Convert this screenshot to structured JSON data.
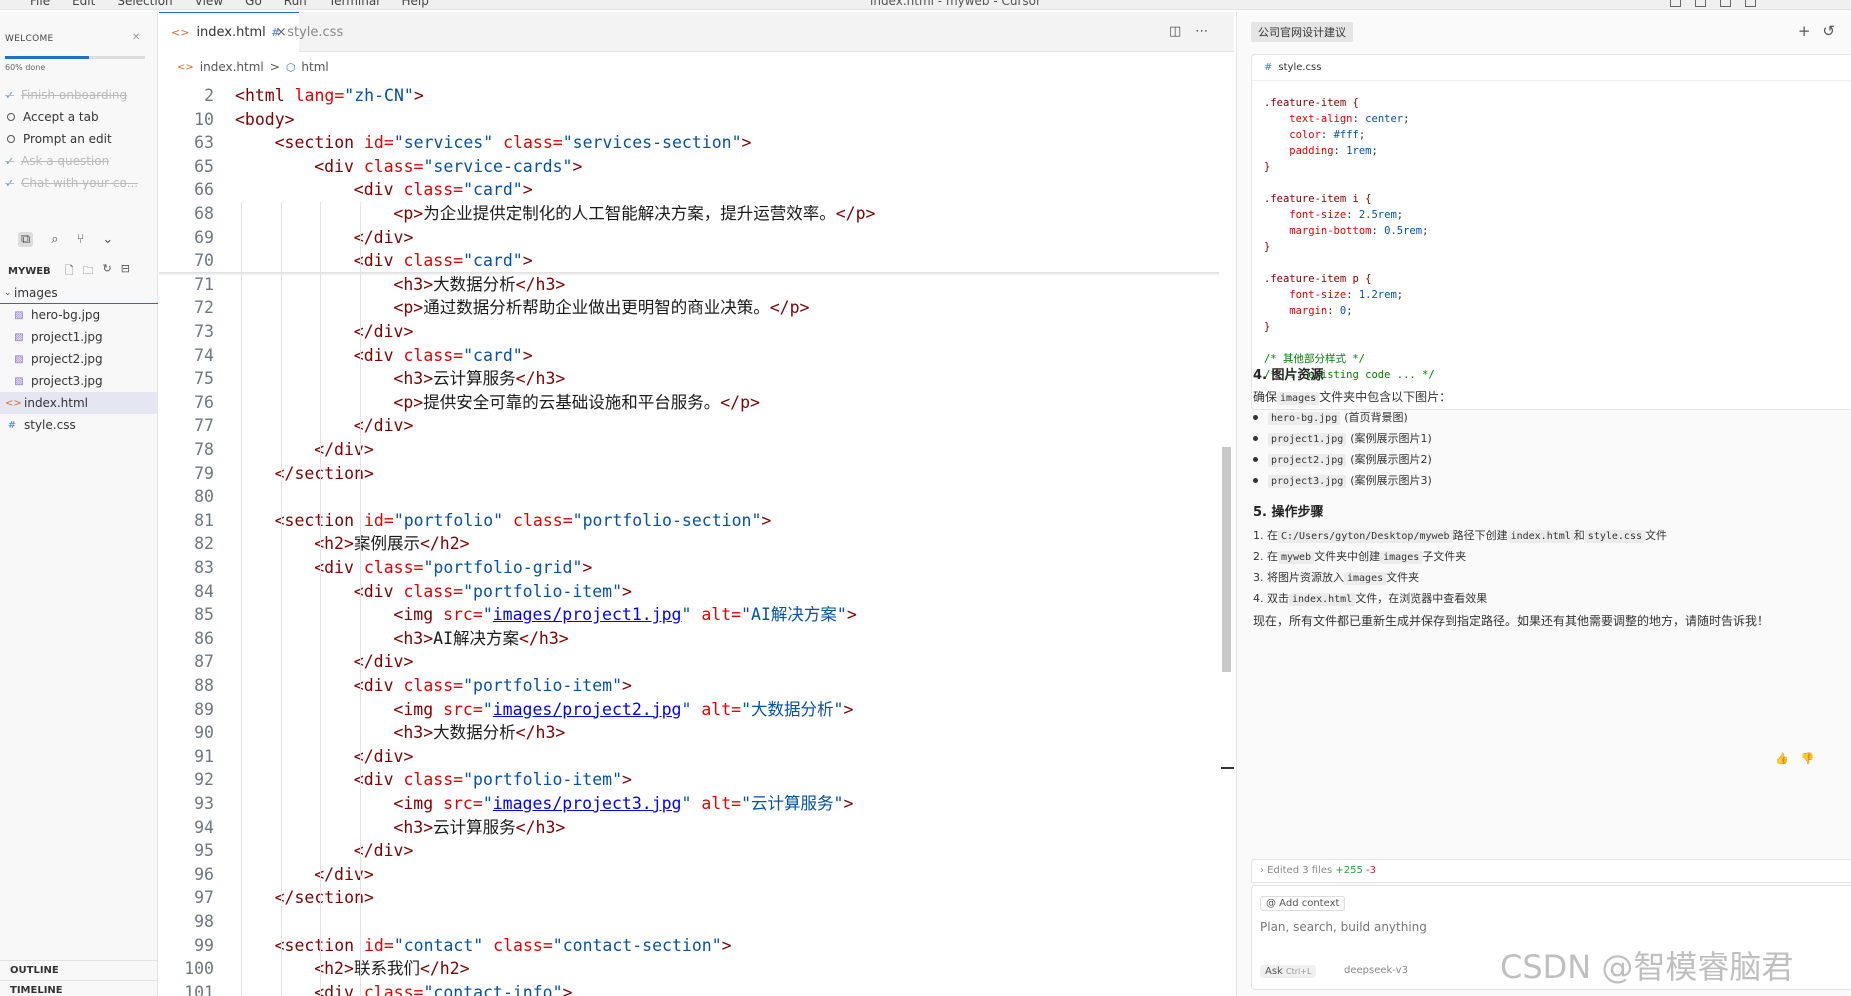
{
  "menubar": {
    "menus": [
      "File",
      "Edit",
      "Selection",
      "View",
      "Go",
      "Run",
      "Terminal",
      "Help"
    ],
    "window_title": "index.html - myweb - Cursor"
  },
  "welcome": {
    "title": "WELCOME",
    "progress_label": "60% done",
    "progress_fraction": 0.6,
    "items": [
      {
        "label": "Finish onboarding",
        "done": true
      },
      {
        "label": "Accept a tab",
        "done": false
      },
      {
        "label": "Prompt an edit",
        "done": false
      },
      {
        "label": "Ask a question",
        "done": true
      },
      {
        "label": "Chat with your co...",
        "done": true
      }
    ]
  },
  "explorer": {
    "title": "MYWEB",
    "folder": "images",
    "files": [
      "hero-bg.jpg",
      "project1.jpg",
      "project2.jpg",
      "project3.jpg"
    ],
    "root_files": [
      "index.html",
      "style.css"
    ],
    "outline": "OUTLINE",
    "timeline": "TIMELINE"
  },
  "tabs": [
    {
      "label": "index.html",
      "active": true,
      "close": "×"
    },
    {
      "label": "style.css",
      "active": false
    }
  ],
  "breadcrumb": {
    "file": "index.html",
    "sep": ">",
    "node": "html"
  },
  "code_lines": [
    {
      "n": "2",
      "ind": 0,
      "h": [
        [
          "<",
          "t"
        ],
        [
          "html ",
          "t"
        ],
        [
          "lang=",
          "a"
        ],
        [
          "\"zh-CN\"",
          "v"
        ],
        [
          ">",
          "t"
        ]
      ]
    },
    {
      "n": "10",
      "ind": 0,
      "h": [
        [
          "<body>",
          "t"
        ]
      ]
    },
    {
      "n": "63",
      "ind": 1,
      "h": [
        [
          "<section ",
          "t"
        ],
        [
          "id=",
          "a"
        ],
        [
          "\"services\" ",
          "v"
        ],
        [
          "class=",
          "a"
        ],
        [
          "\"services-section\"",
          "v"
        ],
        [
          ">",
          "t"
        ]
      ]
    },
    {
      "n": "65",
      "ind": 2,
      "h": [
        [
          "<div ",
          "t"
        ],
        [
          "class=",
          "a"
        ],
        [
          "\"service-cards\"",
          "v"
        ],
        [
          ">",
          "t"
        ]
      ]
    },
    {
      "n": "66",
      "ind": 3,
      "h": [
        [
          "<div ",
          "t"
        ],
        [
          "class=",
          "a"
        ],
        [
          "\"card\"",
          "v"
        ],
        [
          ">",
          "t"
        ]
      ]
    },
    {
      "n": "68",
      "ind": 4,
      "h": [
        [
          "<p>",
          "t"
        ],
        [
          "为企业提供定制化的人工智能解决方案，提升运营效率。",
          ""
        ],
        [
          "</p>",
          "t"
        ]
      ]
    },
    {
      "n": "69",
      "ind": 3,
      "h": [
        [
          "</div>",
          "t"
        ]
      ]
    },
    {
      "n": "70",
      "ind": 3,
      "h": [
        [
          "<div ",
          "t"
        ],
        [
          "class=",
          "a"
        ],
        [
          "\"card\"",
          "v"
        ],
        [
          ">",
          "t"
        ]
      ]
    },
    {
      "n": "71",
      "ind": 4,
      "h": [
        [
          "<h3>",
          "t"
        ],
        [
          "大数据分析",
          ""
        ],
        [
          "</h3>",
          "t"
        ]
      ]
    },
    {
      "n": "72",
      "ind": 4,
      "h": [
        [
          "<p>",
          "t"
        ],
        [
          "通过数据分析帮助企业做出更明智的商业决策。",
          ""
        ],
        [
          "</p>",
          "t"
        ]
      ]
    },
    {
      "n": "73",
      "ind": 3,
      "h": [
        [
          "</div>",
          "t"
        ]
      ]
    },
    {
      "n": "74",
      "ind": 3,
      "h": [
        [
          "<div ",
          "t"
        ],
        [
          "class=",
          "a"
        ],
        [
          "\"card\"",
          "v"
        ],
        [
          ">",
          "t"
        ]
      ]
    },
    {
      "n": "75",
      "ind": 4,
      "h": [
        [
          "<h3>",
          "t"
        ],
        [
          "云计算服务",
          ""
        ],
        [
          "</h3>",
          "t"
        ]
      ]
    },
    {
      "n": "76",
      "ind": 4,
      "h": [
        [
          "<p>",
          "t"
        ],
        [
          "提供安全可靠的云基础设施和平台服务。",
          ""
        ],
        [
          "</p>",
          "t"
        ]
      ]
    },
    {
      "n": "77",
      "ind": 3,
      "h": [
        [
          "</div>",
          "t"
        ]
      ]
    },
    {
      "n": "78",
      "ind": 2,
      "h": [
        [
          "</div>",
          "t"
        ]
      ]
    },
    {
      "n": "79",
      "ind": 1,
      "h": [
        [
          "</section>",
          "t"
        ]
      ]
    },
    {
      "n": "80",
      "ind": 0,
      "h": []
    },
    {
      "n": "81",
      "ind": 1,
      "h": [
        [
          "<section ",
          "t"
        ],
        [
          "id=",
          "a"
        ],
        [
          "\"portfolio\" ",
          "v"
        ],
        [
          "class=",
          "a"
        ],
        [
          "\"portfolio-section\"",
          "v"
        ],
        [
          ">",
          "t"
        ]
      ]
    },
    {
      "n": "82",
      "ind": 2,
      "h": [
        [
          "<h2>",
          "t"
        ],
        [
          "案例展示",
          ""
        ],
        [
          "</h2>",
          "t"
        ]
      ]
    },
    {
      "n": "83",
      "ind": 2,
      "h": [
        [
          "<div ",
          "t"
        ],
        [
          "class=",
          "a"
        ],
        [
          "\"portfolio-grid\"",
          "v"
        ],
        [
          ">",
          "t"
        ]
      ]
    },
    {
      "n": "84",
      "ind": 3,
      "h": [
        [
          "<div ",
          "t"
        ],
        [
          "class=",
          "a"
        ],
        [
          "\"portfolio-item\"",
          "v"
        ],
        [
          ">",
          "t"
        ]
      ]
    },
    {
      "n": "85",
      "ind": 4,
      "h": [
        [
          "<img ",
          "t"
        ],
        [
          "src=",
          "a"
        ],
        [
          "\"",
          "v"
        ],
        [
          "images/project1.jpg",
          "lk"
        ],
        [
          "\" ",
          "v"
        ],
        [
          "alt=",
          "a"
        ],
        [
          "\"AI解决方案\"",
          "v"
        ],
        [
          ">",
          "t"
        ]
      ]
    },
    {
      "n": "86",
      "ind": 4,
      "h": [
        [
          "<h3>",
          "t"
        ],
        [
          "AI解决方案",
          ""
        ],
        [
          "</h3>",
          "t"
        ]
      ]
    },
    {
      "n": "87",
      "ind": 3,
      "h": [
        [
          "</div>",
          "t"
        ]
      ]
    },
    {
      "n": "88",
      "ind": 3,
      "h": [
        [
          "<div ",
          "t"
        ],
        [
          "class=",
          "a"
        ],
        [
          "\"portfolio-item\"",
          "v"
        ],
        [
          ">",
          "t"
        ]
      ]
    },
    {
      "n": "89",
      "ind": 4,
      "h": [
        [
          "<img ",
          "t"
        ],
        [
          "src=",
          "a"
        ],
        [
          "\"",
          "v"
        ],
        [
          "images/project2.jpg",
          "lk"
        ],
        [
          "\" ",
          "v"
        ],
        [
          "alt=",
          "a"
        ],
        [
          "\"大数据分析\"",
          "v"
        ],
        [
          ">",
          "t"
        ]
      ]
    },
    {
      "n": "90",
      "ind": 4,
      "h": [
        [
          "<h3>",
          "t"
        ],
        [
          "大数据分析",
          ""
        ],
        [
          "</h3>",
          "t"
        ]
      ]
    },
    {
      "n": "91",
      "ind": 3,
      "h": [
        [
          "</div>",
          "t"
        ]
      ]
    },
    {
      "n": "92",
      "ind": 3,
      "h": [
        [
          "<div ",
          "t"
        ],
        [
          "class=",
          "a"
        ],
        [
          "\"portfolio-item\"",
          "v"
        ],
        [
          ">",
          "t"
        ]
      ]
    },
    {
      "n": "93",
      "ind": 4,
      "h": [
        [
          "<img ",
          "t"
        ],
        [
          "src=",
          "a"
        ],
        [
          "\"",
          "v"
        ],
        [
          "images/project3.jpg",
          "lk"
        ],
        [
          "\" ",
          "v"
        ],
        [
          "alt=",
          "a"
        ],
        [
          "\"云计算服务\"",
          "v"
        ],
        [
          ">",
          "t"
        ]
      ]
    },
    {
      "n": "94",
      "ind": 4,
      "h": [
        [
          "<h3>",
          "t"
        ],
        [
          "云计算服务",
          ""
        ],
        [
          "</h3>",
          "t"
        ]
      ]
    },
    {
      "n": "95",
      "ind": 3,
      "h": [
        [
          "</div>",
          "t"
        ]
      ]
    },
    {
      "n": "96",
      "ind": 2,
      "h": [
        [
          "</div>",
          "t"
        ]
      ]
    },
    {
      "n": "97",
      "ind": 1,
      "h": [
        [
          "</section>",
          "t"
        ]
      ]
    },
    {
      "n": "98",
      "ind": 0,
      "h": []
    },
    {
      "n": "99",
      "ind": 1,
      "h": [
        [
          "<section ",
          "t"
        ],
        [
          "id=",
          "a"
        ],
        [
          "\"contact\" ",
          "v"
        ],
        [
          "class=",
          "a"
        ],
        [
          "\"contact-section\"",
          "v"
        ],
        [
          ">",
          "t"
        ]
      ]
    },
    {
      "n": "100",
      "ind": 2,
      "h": [
        [
          "<h2>",
          "t"
        ],
        [
          "联系我们",
          ""
        ],
        [
          "</h2>",
          "t"
        ]
      ]
    },
    {
      "n": "101",
      "ind": 2,
      "h": [
        [
          "<div ",
          "t"
        ],
        [
          "class=",
          "a"
        ],
        [
          "\"contact-info\"",
          "v"
        ],
        [
          ">",
          "t"
        ]
      ]
    }
  ],
  "chat": {
    "title": "公司官网设计建议",
    "code_file": "style.css",
    "css_lines": [
      [
        [
          ".feature-item {",
          "sel"
        ]
      ],
      [
        [
          "    text-align",
          "pr"
        ],
        [
          ": ",
          ""
        ],
        [
          "center",
          "pv"
        ],
        [
          ";",
          ""
        ]
      ],
      [
        [
          "    color",
          "pr"
        ],
        [
          ": ",
          ""
        ],
        [
          "#fff",
          "pv"
        ],
        [
          ";",
          ""
        ]
      ],
      [
        [
          "    padding",
          "pr"
        ],
        [
          ": ",
          ""
        ],
        [
          "1rem",
          "pv"
        ],
        [
          ";",
          ""
        ]
      ],
      [
        [
          "}",
          "sel"
        ]
      ],
      [],
      [
        [
          ".feature-item i {",
          "sel"
        ]
      ],
      [
        [
          "    font-size",
          "pr"
        ],
        [
          ": ",
          ""
        ],
        [
          "2.5rem",
          "pv"
        ],
        [
          ";",
          ""
        ]
      ],
      [
        [
          "    margin-bottom",
          "pr"
        ],
        [
          ": ",
          ""
        ],
        [
          "0.5rem",
          "pv"
        ],
        [
          ";",
          ""
        ]
      ],
      [
        [
          "}",
          "sel"
        ]
      ],
      [],
      [
        [
          ".feature-item p {",
          "sel"
        ]
      ],
      [
        [
          "    font-size",
          "pr"
        ],
        [
          ": ",
          ""
        ],
        [
          "1.2rem",
          "pv"
        ],
        [
          ";",
          ""
        ]
      ],
      [
        [
          "    margin",
          "pr"
        ],
        [
          ": ",
          ""
        ],
        [
          "0",
          "pv"
        ],
        [
          ";",
          ""
        ]
      ],
      [
        [
          "}",
          "sel"
        ]
      ],
      [],
      [
        [
          "/* 其他部分样式 */",
          "cm"
        ]
      ],
      [
        [
          "/* ... existing code ... */",
          "cm"
        ]
      ]
    ],
    "sec4_title": "4. 图片资源",
    "sec4_intro_pre": "确保",
    "sec4_intro_code": "images",
    "sec4_intro_post": "文件夹中包含以下图片：",
    "images_list": [
      {
        "file": "hero-bg.jpg",
        "desc": "(首页背景图)"
      },
      {
        "file": "project1.jpg",
        "desc": "(案例展示图片1)"
      },
      {
        "file": "project2.jpg",
        "desc": "(案例展示图片2)"
      },
      {
        "file": "project3.jpg",
        "desc": "(案例展示图片3)"
      }
    ],
    "sec5_title": "5. 操作步骤",
    "steps": [
      [
        [
          "1. 在",
          ""
        ],
        [
          "C:/Users/gyton/Desktop/myweb",
          "c"
        ],
        [
          "路径下创建",
          ""
        ],
        [
          "index.html",
          "c"
        ],
        [
          "和",
          ""
        ],
        [
          "style.css",
          "c"
        ],
        [
          "文件",
          ""
        ]
      ],
      [
        [
          "2. 在",
          ""
        ],
        [
          "myweb",
          "c"
        ],
        [
          "文件夹中创建",
          ""
        ],
        [
          "images",
          "c"
        ],
        [
          "子文件夹",
          ""
        ]
      ],
      [
        [
          "3. 将图片资源放入",
          ""
        ],
        [
          "images",
          "c"
        ],
        [
          "文件夹",
          ""
        ]
      ],
      [
        [
          "4. 双击",
          ""
        ],
        [
          "index.html",
          "c"
        ],
        [
          "文件，在浏览器中查看效果",
          ""
        ]
      ]
    ],
    "closing": "现在，所有文件都已重新生成并保存到指定路径。如果还有其他需要调整的地方，请随时告诉我！",
    "edited_prefix": "› Edited 3 files",
    "edited_plus": "+255",
    "edited_minus": "-3",
    "add_context": "@ Add context",
    "input_placeholder": "Plan, search, build anything",
    "mode_label": "Ask",
    "mode_key": "Ctrl+L",
    "model_label": "deepseek-v3"
  },
  "watermark": "CSDN @智模睿脑君"
}
